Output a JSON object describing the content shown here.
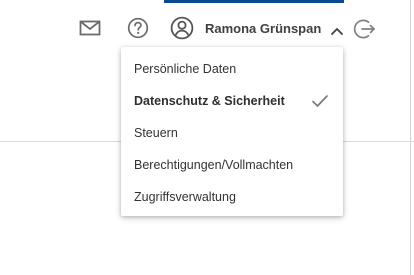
{
  "header": {
    "user_name": "Ramona Grünspan",
    "icons": {
      "mail": "mail-icon",
      "help": "help-icon",
      "user": "user-icon",
      "chevron": "chevron-up-icon",
      "logout": "logout-icon"
    }
  },
  "dropdown": {
    "items": [
      {
        "label": "Persönliche Daten",
        "selected": false
      },
      {
        "label": "Datenschutz & Sicherheit",
        "selected": true
      },
      {
        "label": "Steuern",
        "selected": false
      },
      {
        "label": "Berechtigungen/Vollmachten",
        "selected": false
      },
      {
        "label": "Zugriffsverwaltung",
        "selected": false
      }
    ],
    "selected_icon": "check-icon"
  },
  "colors": {
    "accent": "#0b4a8f",
    "icon": "#6b6b6b",
    "text": "#333333",
    "divider": "#dcdcdc"
  }
}
